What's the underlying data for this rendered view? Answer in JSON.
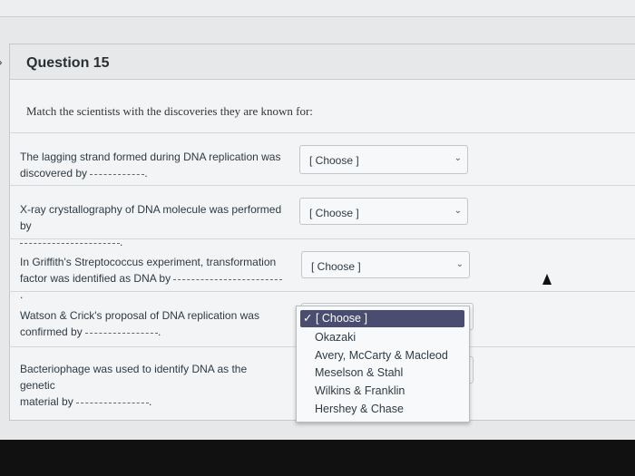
{
  "question": {
    "title": "Question 15",
    "instruction": "Match the scientists with the discoveries they are known for:"
  },
  "rows": [
    {
      "line1": "The lagging strand formed during DNA replication was",
      "line2": "discovered by",
      "select": "[ Choose ]"
    },
    {
      "line1": "X-ray crystallography of DNA molecule was performed by",
      "line2": "",
      "select": "[ Choose ]"
    },
    {
      "line1": "In Griffith's Streptococcus experiment, transformation",
      "line2": "factor was identified as DNA by",
      "select": "[ Choose ]"
    },
    {
      "line1": "Watson & Crick's proposal of DNA replication was",
      "line2": "confirmed by",
      "select": ""
    },
    {
      "line1": "Bacteriophage was used to identify DNA as the genetic",
      "line2": "material by",
      "select": ""
    }
  ],
  "dropdown": {
    "options": [
      "✓ [ Choose ]",
      "Okazaki",
      "Avery, McCarty & Macleod",
      "Meselson & Stahl",
      "Wilkins & Franklin",
      "Hershey & Chase"
    ]
  }
}
